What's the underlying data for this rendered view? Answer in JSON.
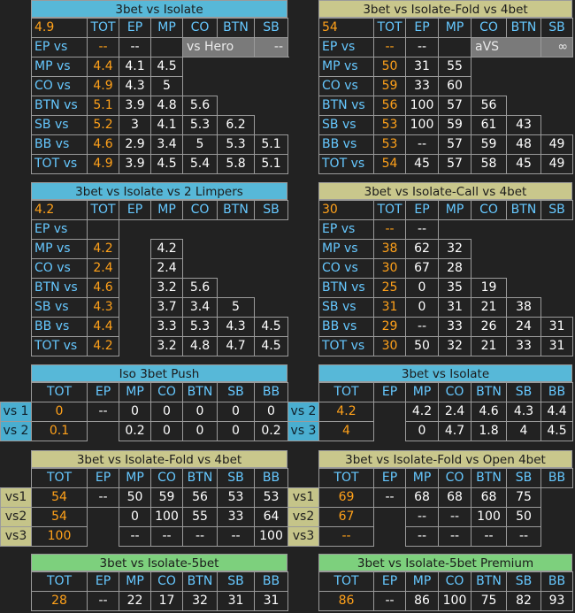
{
  "titles": {
    "t1": "3bet vs Isolate",
    "t2": "3bet vs Isolate-Fold vs 4bet",
    "t3": "3bet vs Isolate vs 2 Limpers",
    "t4": "3bet vs Isolate-Call vs 4bet",
    "t5": "Iso 3bet Push",
    "t6": "3bet vs Isolate",
    "t7": "3bet vs Isolate-Fold vs 4bet",
    "t8": "3bet vs Isolate-Fold vs Open 4bet",
    "t9": "3bet vs Isolate-5bet",
    "t10": "3bet vs Isolate-5bet Premium"
  },
  "headers": {
    "tot": "TOT",
    "ep": "EP",
    "mp": "MP",
    "co": "CO",
    "btn": "BTN",
    "sb": "SB",
    "bb": "BB"
  },
  "rows": {
    "ep": "EP vs",
    "mp": "MP vs",
    "co": "CO vs",
    "btn": "BTN vs",
    "sb": "SB vs",
    "bb": "BB vs",
    "tot": "TOT vs"
  },
  "side": {
    "vs1": "vs 1",
    "vs2": "vs 2",
    "vs3": "vs 3",
    "c1": "vs1",
    "c2": "vs2",
    "c3": "vs3"
  },
  "t1": {
    "corner": "4.9",
    "ep_tot": "--",
    "ep_ep": "--",
    "vs_hero": "vs Hero",
    "vs_hero_val": "--",
    "mp": [
      "4.4",
      "4.1",
      "4.5"
    ],
    "co": [
      "4.9",
      "4.3",
      "5"
    ],
    "btn": [
      "5.1",
      "3.9",
      "4.8",
      "5.6"
    ],
    "sb": [
      "5.2",
      "3",
      "4.1",
      "5.3",
      "6.2"
    ],
    "bb": [
      "4.6",
      "2.9",
      "3.4",
      "5",
      "5.3",
      "5.1"
    ],
    "tot": [
      "4.9",
      "3.9",
      "4.5",
      "5.4",
      "5.8",
      "5.1"
    ]
  },
  "t2": {
    "corner": "54",
    "ep_tot": "--",
    "ep_ep": "--",
    "avs": "aVS",
    "avs_val": "∞",
    "mp": [
      "50",
      "31",
      "55"
    ],
    "co": [
      "59",
      "33",
      "60"
    ],
    "btn": [
      "56",
      "100",
      "57",
      "56"
    ],
    "sb": [
      "53",
      "100",
      "59",
      "61",
      "43"
    ],
    "bb": [
      "53",
      "--",
      "57",
      "59",
      "48",
      "49"
    ],
    "tot": [
      "54",
      "45",
      "57",
      "58",
      "45",
      "49"
    ]
  },
  "t3": {
    "corner": "4.2",
    "mp": [
      "4.2",
      "4.2"
    ],
    "co": [
      "2.4",
      "2.4"
    ],
    "btn": [
      "4.6",
      "3.2",
      "5.6"
    ],
    "sb": [
      "4.3",
      "3.7",
      "3.4",
      "5"
    ],
    "bb": [
      "4.4",
      "3.3",
      "5.3",
      "4.3",
      "4.5"
    ],
    "tot": [
      "4.2",
      "3.2",
      "4.8",
      "4.7",
      "4.5"
    ]
  },
  "t4": {
    "corner": "30",
    "ep_tot": "--",
    "ep_ep": "--",
    "mp": [
      "38",
      "62",
      "32"
    ],
    "co": [
      "30",
      "67",
      "28"
    ],
    "btn": [
      "25",
      "0",
      "35",
      "19"
    ],
    "sb": [
      "31",
      "0",
      "31",
      "21",
      "38"
    ],
    "bb": [
      "29",
      "--",
      "33",
      "26",
      "24",
      "31"
    ],
    "tot": [
      "30",
      "50",
      "32",
      "21",
      "33",
      "31"
    ]
  },
  "t5": {
    "r1": [
      "0",
      "--",
      "0",
      "0",
      "0",
      "0",
      "0"
    ],
    "r2": [
      "0.1",
      "",
      "0.2",
      "0",
      "0",
      "0",
      "0.2"
    ]
  },
  "t6": {
    "r1": [
      "4.2",
      "",
      "4.2",
      "2.4",
      "4.6",
      "4.3",
      "4.4"
    ],
    "r2": [
      "4",
      "",
      "0",
      "4.7",
      "1.8",
      "4",
      "4.5"
    ]
  },
  "t7": {
    "r1": [
      "54",
      "--",
      "50",
      "59",
      "56",
      "53",
      "53"
    ],
    "r2": [
      "54",
      "",
      "0",
      "100",
      "55",
      "33",
      "64"
    ],
    "r3": [
      "100",
      "",
      "--",
      "--",
      "--",
      "--",
      "100"
    ]
  },
  "t8": {
    "r1": [
      "69",
      "--",
      "68",
      "68",
      "68",
      "75",
      ""
    ],
    "r2": [
      "67",
      "",
      "--",
      "--",
      "100",
      "50",
      ""
    ],
    "r3": [
      "--",
      "",
      "--",
      "--",
      "--",
      "--",
      ""
    ]
  },
  "t9": {
    "r1": [
      "28",
      "--",
      "22",
      "17",
      "32",
      "31",
      "31"
    ]
  },
  "t10": {
    "r1": [
      "86",
      "--",
      "86",
      "100",
      "75",
      "82",
      "93"
    ]
  }
}
